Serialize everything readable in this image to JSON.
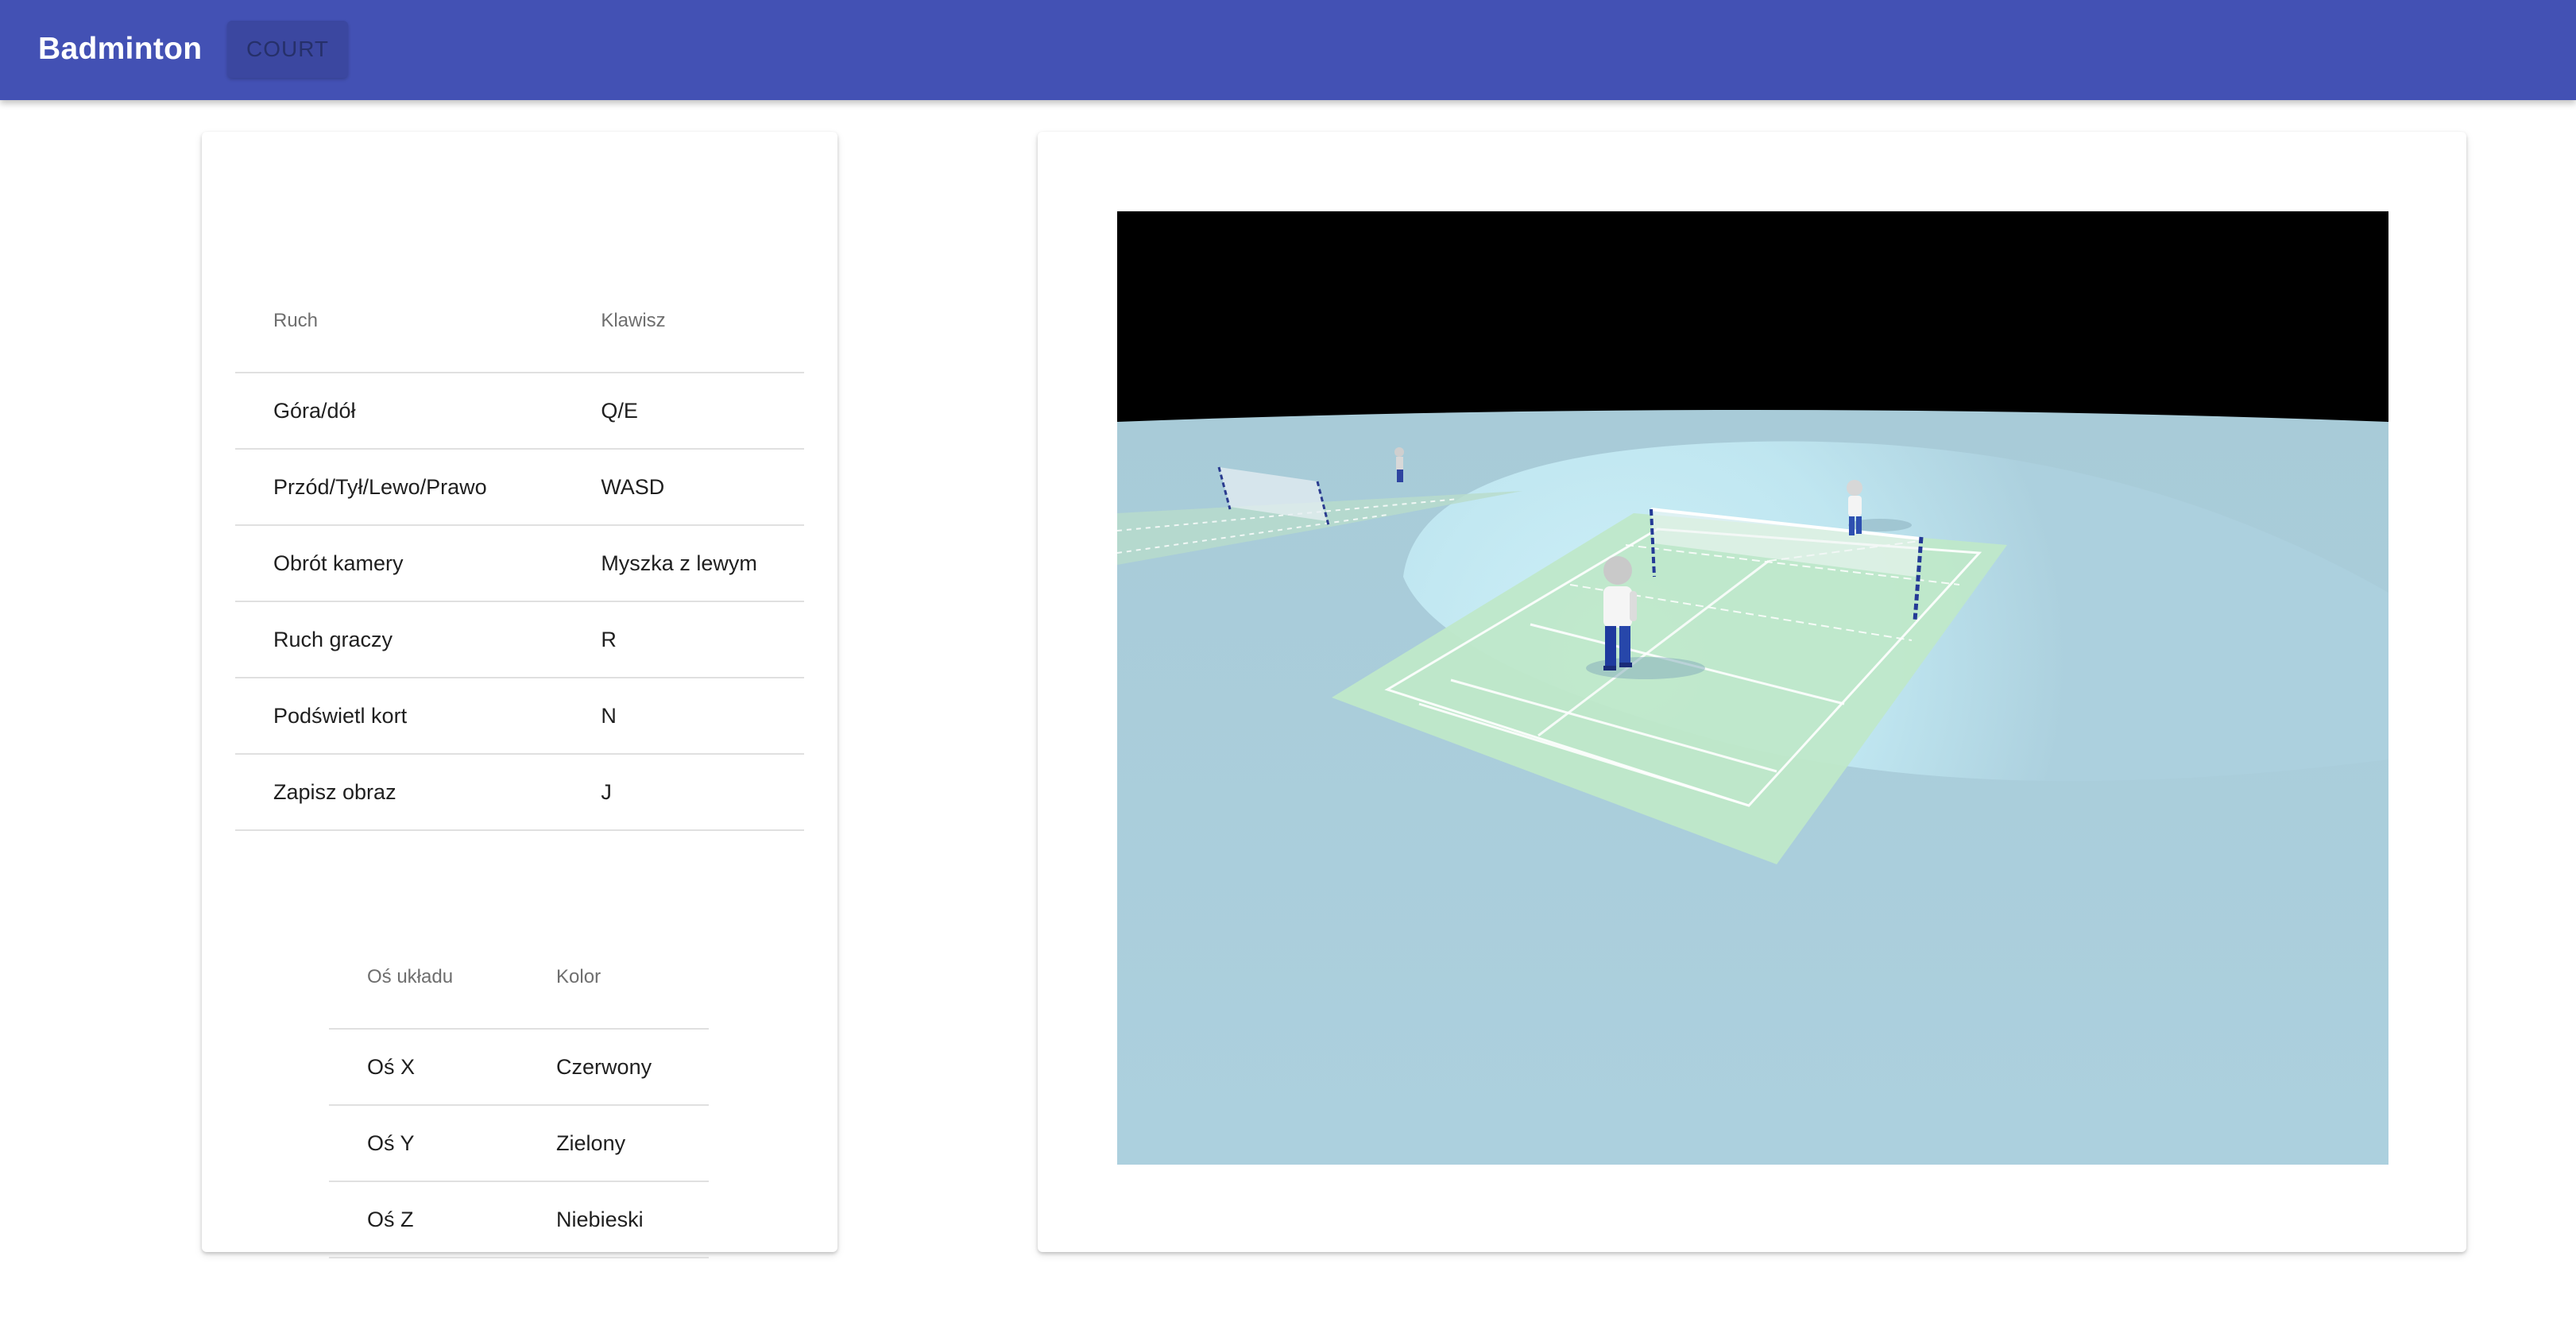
{
  "app": {
    "title": "Badminton",
    "nav_button": "COURT"
  },
  "controls_table": {
    "headers": [
      "Ruch",
      "Klawisz"
    ],
    "rows": [
      {
        "action": "Góra/dół",
        "key": "Q/E"
      },
      {
        "action": "Przód/Tył/Lewo/Prawo",
        "key": "WASD"
      },
      {
        "action": "Obrót kamery",
        "key": "Myszka z lewym"
      },
      {
        "action": "Ruch graczy",
        "key": "R"
      },
      {
        "action": "Podświetl kort",
        "key": "N"
      },
      {
        "action": "Zapisz obraz",
        "key": "J"
      }
    ]
  },
  "axes_table": {
    "headers": [
      "Oś układu",
      "Kolor"
    ],
    "rows": [
      {
        "axis": "Oś X",
        "color": "Czerwony"
      },
      {
        "axis": "Oś Y",
        "color": "Zielony"
      },
      {
        "axis": "Oś Z",
        "color": "Niebieski"
      }
    ]
  },
  "scene": {
    "colors": {
      "sky": "#000000",
      "ground": "#acd0de",
      "court": "#bfe8c9",
      "appbar": "#4351b4"
    }
  }
}
